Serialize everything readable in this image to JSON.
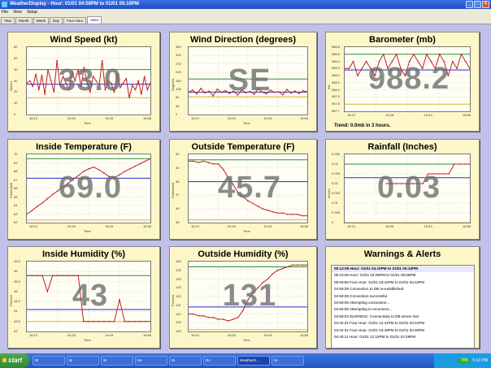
{
  "window": {
    "title": "WeatherDisplay - Hour: 01/01 04:50PM to 01/01 05:10PM"
  },
  "menu": [
    "File",
    "View",
    "Setup"
  ],
  "tabs": [
    "Year",
    "Month",
    "Week",
    "Day",
    "Four Hour",
    "Hour"
  ],
  "active_tab": "Hour",
  "panels": {
    "wind_speed": {
      "title": "Wind Speed (kt)",
      "value": "33.0",
      "ylabel": "Speed",
      "xlabel": "Time"
    },
    "wind_dir": {
      "title": "Wind Direction (degrees)",
      "value": "SE",
      "ylabel": "Degrees",
      "xlabel": "Time"
    },
    "barometer": {
      "title": "Barometer (mb)",
      "value": "988.2",
      "ylabel": "mb",
      "trend": "Trend: 0.0mb in 3 hours."
    },
    "inside_temp": {
      "title": "Inside Temperature (F)",
      "value": "69.0",
      "ylabel": "Fahrenheit",
      "xlabel": "Time"
    },
    "outside_temp": {
      "title": "Outside Temperature (F)",
      "value": "45.7",
      "ylabel": "Fahrenheit",
      "xlabel": "Time"
    },
    "rainfall": {
      "title": "Rainfall (Inches)",
      "value": "0.03",
      "ylabel": "Inches"
    },
    "inside_hum": {
      "title": "Inside Humidity (%)",
      "value": "43",
      "ylabel": "Percent",
      "xlabel": "Time"
    },
    "outside_hum": {
      "title": "Outside Humidity (%)",
      "value": "131",
      "ylabel": "Percent",
      "xlabel": "Time"
    },
    "warnings": {
      "title": "Warnings & Alerts"
    }
  },
  "warnings": [
    "05:12:06 Hour: 01/01 04:10PM to 01/01 05:10PM",
    "05:10:08 Hour: 01/01 04:06PM to 01/01 05:06PM",
    "05:09:55 Four Hour: 01/01 03:42PM to 01/01 04:42PM",
    "04:59:39 Connection to DB re-established",
    "04:59:39 Connection successful.",
    "04:59:06 Attempting connection...",
    "04:59:06 Attempting to reconnect...",
    "04:59:03 WARNING: Connectivity to DB server lost",
    "04:42:31 Four Hour: 01/01 12:41PM to 01/01 04:41PM",
    "04:42:31 Four Hour: 01/01 03:49PM to 01/01 04:40PM",
    "04:40:11 Hour: 01/01 12:16PM to 01/01 04:29PM"
  ],
  "charts": {
    "wind_speed": {
      "yticks": [
        "60",
        "50",
        "40",
        "30",
        "20",
        "10",
        "0"
      ],
      "xticks": [
        "16:13",
        "16:28",
        "16:43",
        "16:58"
      ],
      "ylim": [
        0,
        60
      ],
      "upper": 40,
      "mean": 27,
      "lower": 15,
      "values": [
        28,
        30,
        25,
        36,
        22,
        35,
        18,
        40,
        30,
        20,
        48,
        26,
        34,
        28,
        22,
        38,
        30,
        40,
        25,
        42,
        28,
        20,
        34,
        30,
        26,
        48,
        22,
        30,
        28,
        20,
        36,
        24,
        28,
        32,
        15,
        26,
        22,
        30,
        18,
        34,
        22,
        28
      ]
    },
    "wind_dir": {
      "yticks": [
        "360",
        "315",
        "270",
        "225",
        "180",
        "135",
        "90",
        "45",
        "0"
      ],
      "xticks": [
        "16:13",
        "16:28",
        "16:43",
        "16:58"
      ],
      "ylim": [
        0,
        360
      ],
      "upper": 190,
      "mean": 120,
      "lower": 95,
      "values": [
        120,
        130,
        110,
        140,
        115,
        125,
        100,
        135,
        118,
        128,
        112,
        126,
        104,
        132,
        116,
        124,
        108,
        138,
        120,
        110,
        130,
        118,
        122,
        106,
        134,
        114,
        126,
        112,
        128,
        120
      ]
    },
    "barometer": {
      "yticks": [
        "988.6",
        "988.5",
        "988.4",
        "988.3",
        "988.2",
        "988.1",
        "988.0",
        "987.9",
        "987.8",
        "987.7"
      ],
      "xticks": [
        "16:13",
        "16:28",
        "16:43",
        "16:58"
      ],
      "ylim": [
        987.7,
        988.6
      ],
      "upper": 988.5,
      "mean": 988.28,
      "lower": 987.8,
      "values": [
        988.3,
        988.3,
        988.4,
        988.2,
        988.3,
        988.4,
        988.3,
        988.2,
        988.4,
        988.5,
        988.3,
        988.4,
        988.5,
        988.3,
        988.2,
        988.4,
        988.5,
        988.4,
        988.3,
        988.5,
        988.4,
        988.3,
        988.5,
        988.4,
        988.2,
        988.4,
        988.3,
        988.5,
        988.4,
        988.3
      ]
    },
    "inside_temp": {
      "yticks": [
        "70",
        "69",
        "68",
        "67",
        "66",
        "65",
        "64",
        "63",
        "62"
      ],
      "xticks": [
        "16:13",
        "16:28",
        "16:43",
        "16:58"
      ],
      "ylim": [
        62,
        70
      ],
      "upper": 69.5,
      "mean": 67.2,
      "lower": 62.3,
      "values": [
        63.0,
        63.4,
        63.9,
        64.3,
        64.8,
        65.3,
        65.7,
        66.2,
        66.6,
        67.1,
        67.5,
        68.0,
        68.3,
        68.5,
        68.2,
        67.8,
        67.4,
        67.3,
        67.6,
        68.0,
        68.3,
        68.6,
        68.9,
        69.2,
        69.5
      ]
    },
    "outside_temp": {
      "yticks": [
        "50",
        "49",
        "48",
        "47",
        "46",
        "45"
      ],
      "xticks": [
        "16:13",
        "16:28",
        "16:43",
        "16:58"
      ],
      "ylim": [
        45,
        50
      ],
      "upper": 49.6,
      "mean": 48.0,
      "lower": 45.2,
      "values": [
        49.5,
        49.5,
        49.4,
        49.5,
        49.4,
        49.3,
        49.3,
        48.9,
        48.3,
        47.8,
        47.2,
        46.9,
        46.6,
        46.4,
        46.2,
        46.0,
        45.9,
        45.8,
        45.7,
        45.7,
        45.6,
        45.6,
        45.6,
        45.5,
        45.5
      ]
    },
    "rainfall": {
      "yticks": [
        "0.035",
        "0.03",
        "0.025",
        "0.02",
        "0.015",
        "0.01",
        "0.005",
        "0"
      ],
      "xticks": [
        "16:13",
        "16:28",
        "16:43",
        "16:58"
      ],
      "ylim": [
        0,
        0.035
      ],
      "upper": 0.03,
      "mean": 0.023,
      "lower": 0.0,
      "values": [
        null,
        null,
        null,
        null,
        null,
        null,
        null,
        null,
        0.02,
        0.02,
        0.02,
        0.02,
        0.02,
        0.02,
        0.02,
        0.02,
        0.025,
        0.025,
        0.025,
        0.025,
        0.025,
        0.03,
        0.03,
        0.03,
        0.03
      ]
    },
    "inside_hum": {
      "yticks": [
        "46.5",
        "46",
        "45.5",
        "45",
        "44.5",
        "44",
        "43.5",
        "43"
      ],
      "xticks": [
        "16:13",
        "16:28",
        "16:43",
        "16:58"
      ],
      "ylim": [
        43,
        46.5
      ],
      "upper": 45.8,
      "mean": 44.1,
      "lower": 43.5,
      "values": [
        45.8,
        45.8,
        45.8,
        45.8,
        45.0,
        45.8,
        45.8,
        45.8,
        45.8,
        45.8,
        45.8,
        43.5,
        43.5,
        43.5,
        43.5,
        43.5,
        43.5,
        43.5,
        44.6,
        43.5,
        43.5,
        43.5,
        43.5,
        43.5,
        43.5
      ]
    },
    "outside_hum": {
      "yticks": [
        "140",
        "135",
        "130",
        "125",
        "120",
        "115",
        "110",
        "105",
        "100"
      ],
      "xticks": [
        "16:13",
        "16:28",
        "16:43",
        "16:58"
      ],
      "ylim": [
        100,
        140
      ],
      "upper": 137,
      "mean": 114,
      "lower": 101,
      "values": [
        110,
        110,
        109,
        109,
        108,
        108,
        107,
        107,
        106,
        107,
        108,
        112,
        118,
        122,
        125,
        128,
        130,
        133,
        135,
        136,
        137,
        138,
        138,
        138,
        138
      ]
    }
  },
  "colors": {
    "upper": "#2a8f2a",
    "mean": "#2a2ad0",
    "lower": "#e0b020",
    "line": "#c02020"
  },
  "taskbar": {
    "start": "start",
    "items": [
      "W",
      "Ni",
      "W",
      "Ne",
      "Ni",
      "Do",
      "WeatherD...",
      "Ni"
    ],
    "battery": "78%",
    "clock": "5:12 PM"
  }
}
